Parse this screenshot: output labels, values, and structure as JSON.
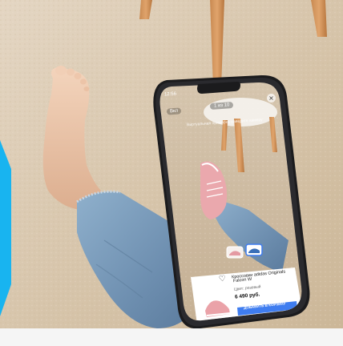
{
  "colors": {
    "carpet": "#d9c8b0",
    "jeans": "#7a9ab8",
    "skin": "#eec9ad",
    "sneaker_pink": "#e9a4a9",
    "accent_blue": "#3f7df0",
    "cyan": "#18b4f0"
  },
  "phone": {
    "status_time": "12:56",
    "back_label": "Вкл",
    "counter": "1 из 10",
    "close_icon": "close-icon",
    "hint_text": "Виртуальная примерка наведите камеру"
  },
  "product_card": {
    "title_line1": "Кроссовки adidas Originals",
    "title_line2": "Falcon W",
    "color_label": "Цвет: розовый",
    "price": "6 490 руб.",
    "add_to_cart": "ДОБАВИТЬ В КОРЗИНУ",
    "favorite_icon": "heart-icon"
  },
  "variants": [
    "pink-sneaker-thumb",
    "white-blue-sneaker-thumb"
  ]
}
